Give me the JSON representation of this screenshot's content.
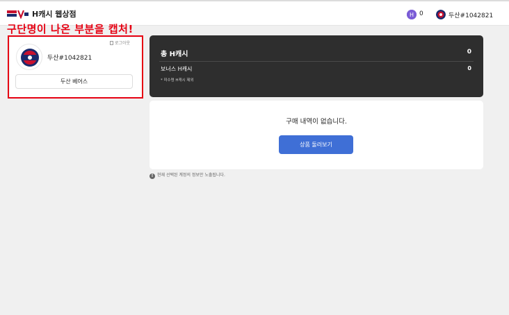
{
  "header": {
    "logo_name": "h-store-logo",
    "site_title": "H캐시 웹상점",
    "coin_count": "0",
    "user_name": "두산#1042821"
  },
  "annotation": {
    "text": "구단명이 나온 부분을 캡처!",
    "color": "#e60012"
  },
  "profile": {
    "logout_label": "로그아웃",
    "user_name": "두산#1042821",
    "team_button_label": "두산 베어스"
  },
  "balance": {
    "total_label": "총 H캐시",
    "total_value": "0",
    "bonus_label": "보너스 H캐시",
    "bonus_value": "0",
    "note": "* 미수령 H캐시 제외"
  },
  "history": {
    "empty_message": "구매 내역이 없습니다.",
    "browse_button_label": "상품 둘러보기"
  },
  "info": {
    "text": "현재 선택된 계정의 정보만 노출됩니다."
  },
  "colors": {
    "accent_blue": "#3f6fd6",
    "dark_card": "#2e2e2e",
    "annotation_red": "#e60012",
    "coin_purple": "#7a5cd6"
  }
}
